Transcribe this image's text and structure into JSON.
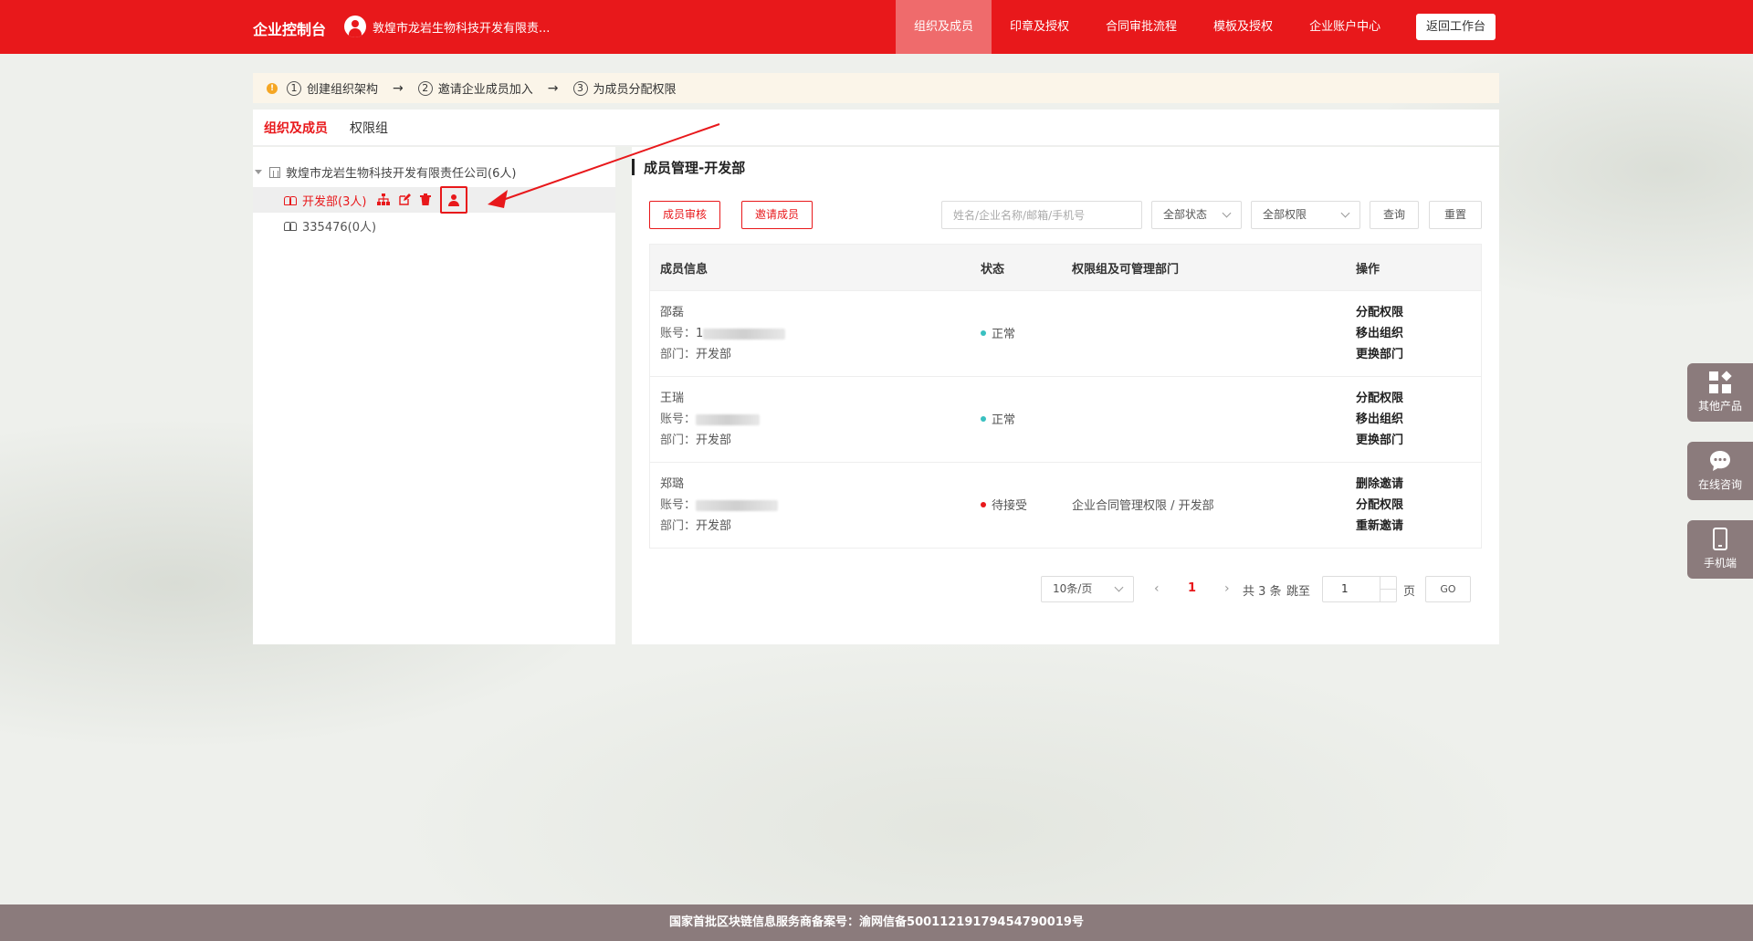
{
  "header": {
    "brand": "企业控制台",
    "company": "敦煌市龙岩生物科技开发有限责...",
    "nav": [
      "组织及成员",
      "印章及授权",
      "合同审批流程",
      "模板及授权",
      "企业账户中心"
    ],
    "active_nav": 0,
    "back_label": "返回工作台"
  },
  "steps": {
    "items": [
      {
        "num": "1",
        "label": "创建组织架构"
      },
      {
        "num": "2",
        "label": "邀请企业成员加入"
      },
      {
        "num": "3",
        "label": "为成员分配权限"
      }
    ],
    "arrow": "→"
  },
  "tabs": [
    "组织及成员",
    "权限组"
  ],
  "tree": {
    "root": "敦煌市龙岩生物科技开发有限责任公司(6人)",
    "children": [
      {
        "label": "开发部(3人)",
        "selected": true
      },
      {
        "label": "335476(0人)",
        "selected": false
      }
    ]
  },
  "panel": {
    "title": "成员管理-开发部",
    "review_btn": "成员审核",
    "invite_btn": "邀请成员",
    "search_placeholder": "姓名/企业名称/邮箱/手机号",
    "status_select": "全部状态",
    "perm_select": "全部权限",
    "query_btn": "查询",
    "reset_btn": "重置"
  },
  "table": {
    "headers": [
      "成员信息",
      "状态",
      "权限组及可管理部门",
      "操作"
    ],
    "account_label": "账号：",
    "dept_label": "部门：",
    "rows": [
      {
        "name": "邵磊",
        "account_prefix": "1",
        "dept": "开发部",
        "status": "正常",
        "status_color": "#39c0c0",
        "perm": "",
        "ops": [
          "分配权限",
          "移出组织",
          "更换部门"
        ]
      },
      {
        "name": "王瑞",
        "account_prefix": "",
        "dept": "开发部",
        "status": "正常",
        "status_color": "#39c0c0",
        "perm": "",
        "ops": [
          "分配权限",
          "移出组织",
          "更换部门"
        ]
      },
      {
        "name": "郑璐",
        "account_prefix": "",
        "dept": "开发部",
        "status": "待接受",
        "status_color": "#e8181b",
        "perm": "企业合同管理权限 / 开发部",
        "ops": [
          "删除邀请",
          "分配权限",
          "重新邀请"
        ]
      }
    ]
  },
  "pagination": {
    "page_size": "10条/页",
    "current": "1",
    "total": "共 3 条",
    "jump_label": "跳至",
    "jump_value": "1",
    "page_suffix": "页",
    "go": "GO"
  },
  "side": [
    "其他产品",
    "在线咨询",
    "手机端"
  ],
  "footer": "国家首批区块链信息服务商备案号：渝网信备50011219179454790019号",
  "colors": {
    "brand_red": "#e8181b",
    "footer": "#8b7b7c"
  }
}
